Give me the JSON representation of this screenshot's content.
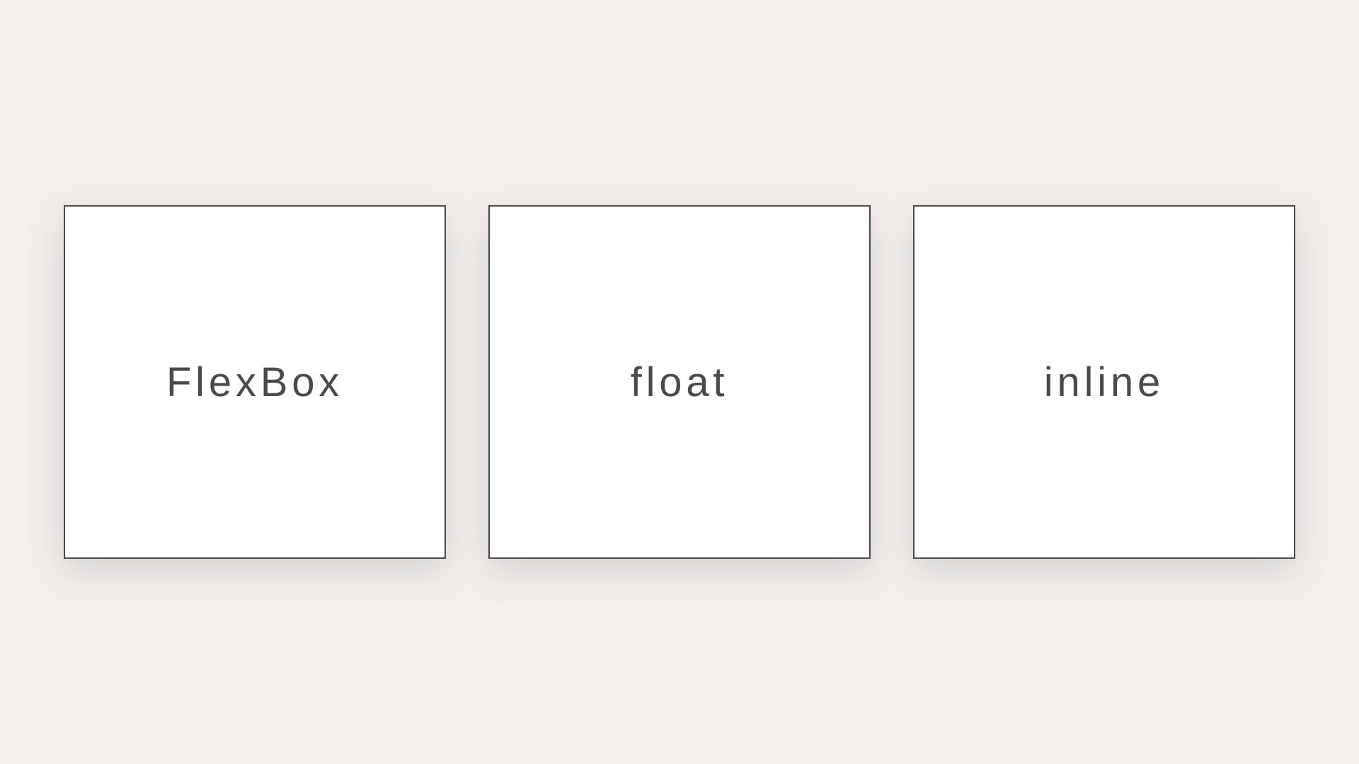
{
  "cards": [
    {
      "label": "FlexBox"
    },
    {
      "label": "float"
    },
    {
      "label": "inline"
    }
  ]
}
